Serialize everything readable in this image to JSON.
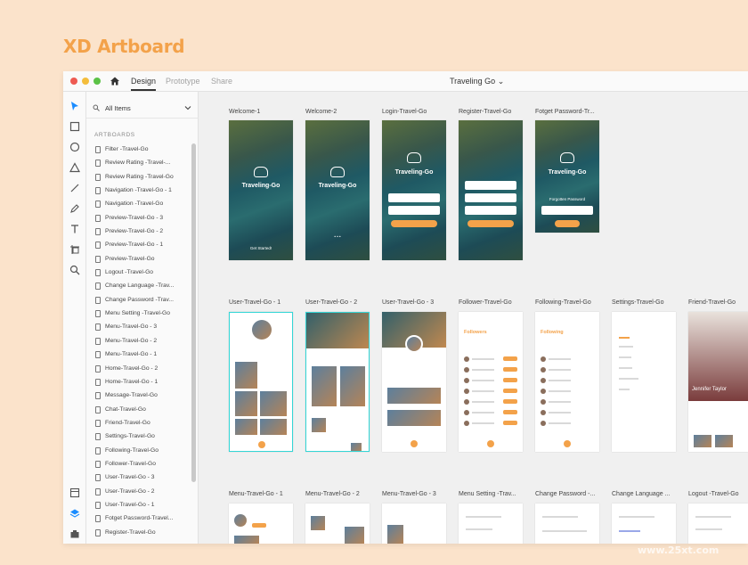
{
  "heading": "XD Artboard",
  "titlebar": {
    "tabs": [
      "Design",
      "Prototype",
      "Share"
    ],
    "active_tab": "Design",
    "document_title": "Traveling Go ⌄"
  },
  "layers_panel": {
    "filter_label": "All Items",
    "section_label": "ARTBOARDS",
    "items": [
      "Filter -Travel-Go",
      "Review Rating -Travel-...",
      "Review Rating -Travel-Go",
      "Navigation -Travel-Go - 1",
      "Navigation -Travel-Go",
      "Preview-Travel-Go - 3",
      "Preview-Travel-Go - 2",
      "Preview-Travel-Go - 1",
      "Preview-Travel-Go",
      "Logout -Travel-Go",
      "Change Language -Trav...",
      "Change Password -Trav...",
      "Menu Setting -Travel-Go",
      "Menu-Travel-Go - 3",
      "Menu-Travel-Go - 2",
      "Menu-Travel-Go - 1",
      "Home-Travel-Go - 2",
      "Home-Travel-Go - 1",
      "Message-Travel-Go",
      "Chat-Travel-Go",
      "Friend-Travel-Go",
      "Settings-Travel-Go",
      "Following-Travel-Go",
      "Follower-Travel-Go",
      "User-Travel-Go - 3",
      "User-Travel-Go - 2",
      "User-Travel-Go - 1",
      "Fotget Password-Travel...",
      "Register-Travel-Go"
    ]
  },
  "canvas": {
    "row1": [
      "Welcome-1",
      "Welcome-2",
      "Login-Travel-Go",
      "Register-Travel-Go",
      "Fotget Password-Tr..."
    ],
    "row2": [
      "User-Travel-Go - 1",
      "User-Travel-Go - 2",
      "User-Travel-Go - 3",
      "Follower-Travel-Go",
      "Following-Travel-Go",
      "Settings-Travel-Go",
      "Friend-Travel-Go"
    ],
    "row3": [
      "Menu-Travel-Go - 1",
      "Menu-Travel-Go - 2",
      "Menu-Travel-Go - 3",
      "Menu Setting -Trav...",
      "Change Password -...",
      "Change Language ...",
      "Logout -Travel-Go"
    ],
    "brand_text": "Traveling-Go",
    "start_label": "Get Started!",
    "followers_title": "Followers",
    "following_title": "Following",
    "friend_name": "Jennifer Taylor",
    "forgot_title": "Forgotten Password"
  },
  "watermark": "www.25xt.com",
  "colors": {
    "accent": "#f3a24a",
    "background": "#fbe3cb"
  }
}
